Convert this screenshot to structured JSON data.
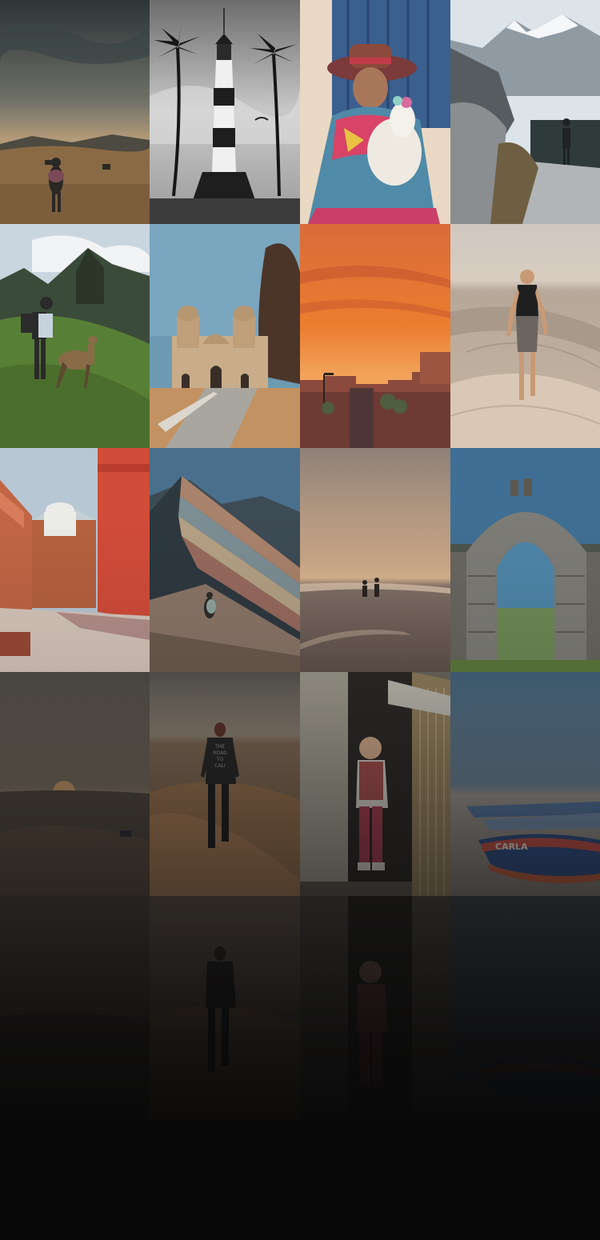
{
  "gallery": {
    "background": "#070707",
    "tiles": [
      {
        "subject": "highland-walker"
      },
      {
        "subject": "lighthouse-palms"
      },
      {
        "subject": "woman-with-alpaca"
      },
      {
        "subject": "snowy-mountain-lake"
      },
      {
        "subject": "machu-picchu-llama"
      },
      {
        "subject": "colonial-church"
      },
      {
        "subject": "orange-sunset-city"
      },
      {
        "subject": "desert-walker"
      },
      {
        "subject": "red-monastery-walls"
      },
      {
        "subject": "rainbow-mountain"
      },
      {
        "subject": "beach-couple"
      },
      {
        "subject": "stone-arch"
      },
      {
        "subject": "desert-sunset"
      },
      {
        "subject": "dune-man-shirt"
      },
      {
        "subject": "child-in-doorway"
      },
      {
        "subject": "beach-boats"
      },
      {
        "subject": "desert-sunset-faded"
      },
      {
        "subject": "dune-man-faded"
      },
      {
        "subject": "child-faded"
      },
      {
        "subject": "boats-faded"
      }
    ],
    "tile_text": {
      "shirt_print": [
        "THE",
        "ROAD",
        "TO",
        "CALI"
      ],
      "boat_name": "CARLA"
    }
  }
}
